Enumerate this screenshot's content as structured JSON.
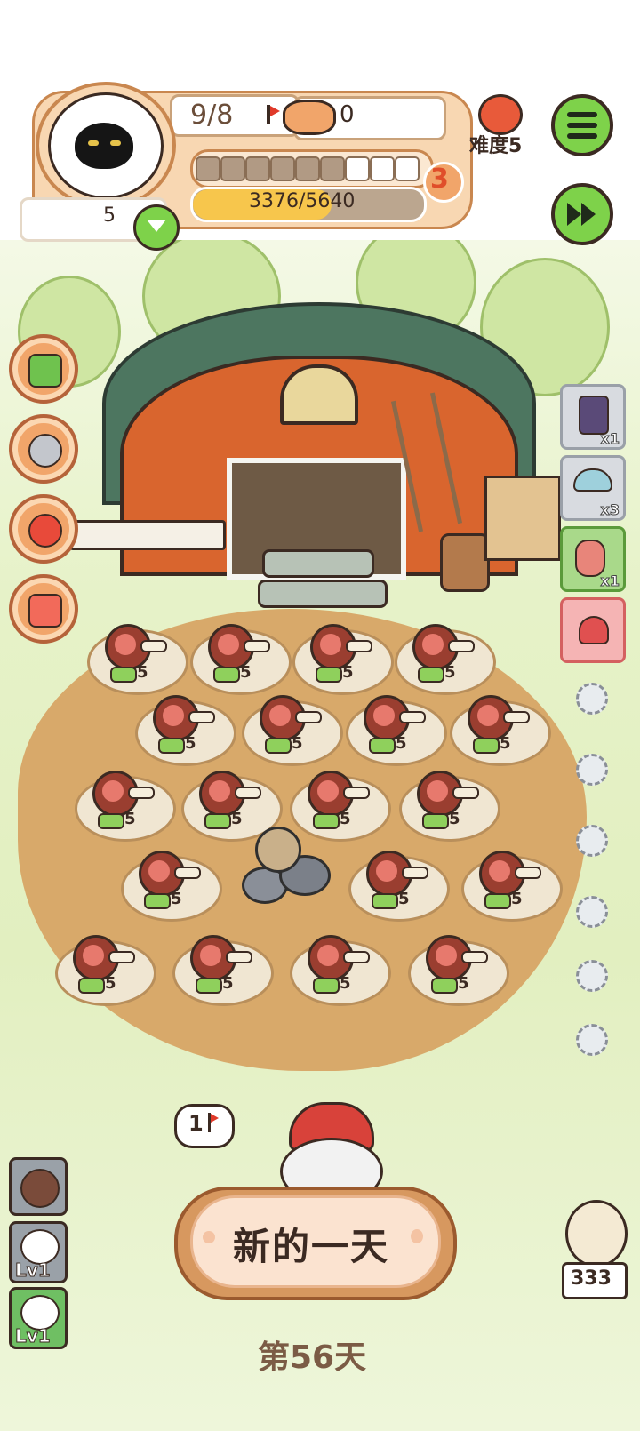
{
  "hud": {
    "flag_count": "9/8",
    "food_count": "0",
    "difficulty_label": "难度5",
    "level_value": "5",
    "progress_text": "3376/5640",
    "progress_fraction": 0.599,
    "segments_filled": 6,
    "segments_total": 9,
    "badge_number": "3"
  },
  "field": {
    "plots": [
      {
        "count": "5"
      },
      {
        "count": "5"
      },
      {
        "count": "5"
      },
      {
        "count": "5"
      },
      {
        "count": "5"
      },
      {
        "count": "5"
      },
      {
        "count": "5"
      },
      {
        "count": "5"
      },
      {
        "count": "5"
      },
      {
        "count": "5"
      },
      {
        "count": "5"
      },
      {
        "count": "5"
      },
      {
        "count": "5"
      },
      {
        "count": "5"
      },
      {
        "count": "5"
      },
      {
        "count": "5"
      },
      {
        "count": "5"
      },
      {
        "count": "5"
      },
      {
        "count": "5"
      }
    ]
  },
  "right_items": [
    {
      "icon": "potion-jar-icon",
      "count": "x1"
    },
    {
      "icon": "mushroom-icon",
      "count": "x3"
    },
    {
      "icon": "worm-icon",
      "count": "x1"
    },
    {
      "icon": "heart-card-icon",
      "count": ""
    }
  ],
  "bubble": {
    "value": "1"
  },
  "bottom": {
    "new_day_button": "新的一天",
    "day_label": "第56天",
    "left_level_1": "Lv1",
    "left_level_2": "Lv1",
    "owl_count": "333"
  },
  "colors": {
    "accent_orange": "#f1a56a",
    "green_button": "#7ed24a",
    "soil": "#d8a96a",
    "barn_red": "#d9652e"
  }
}
